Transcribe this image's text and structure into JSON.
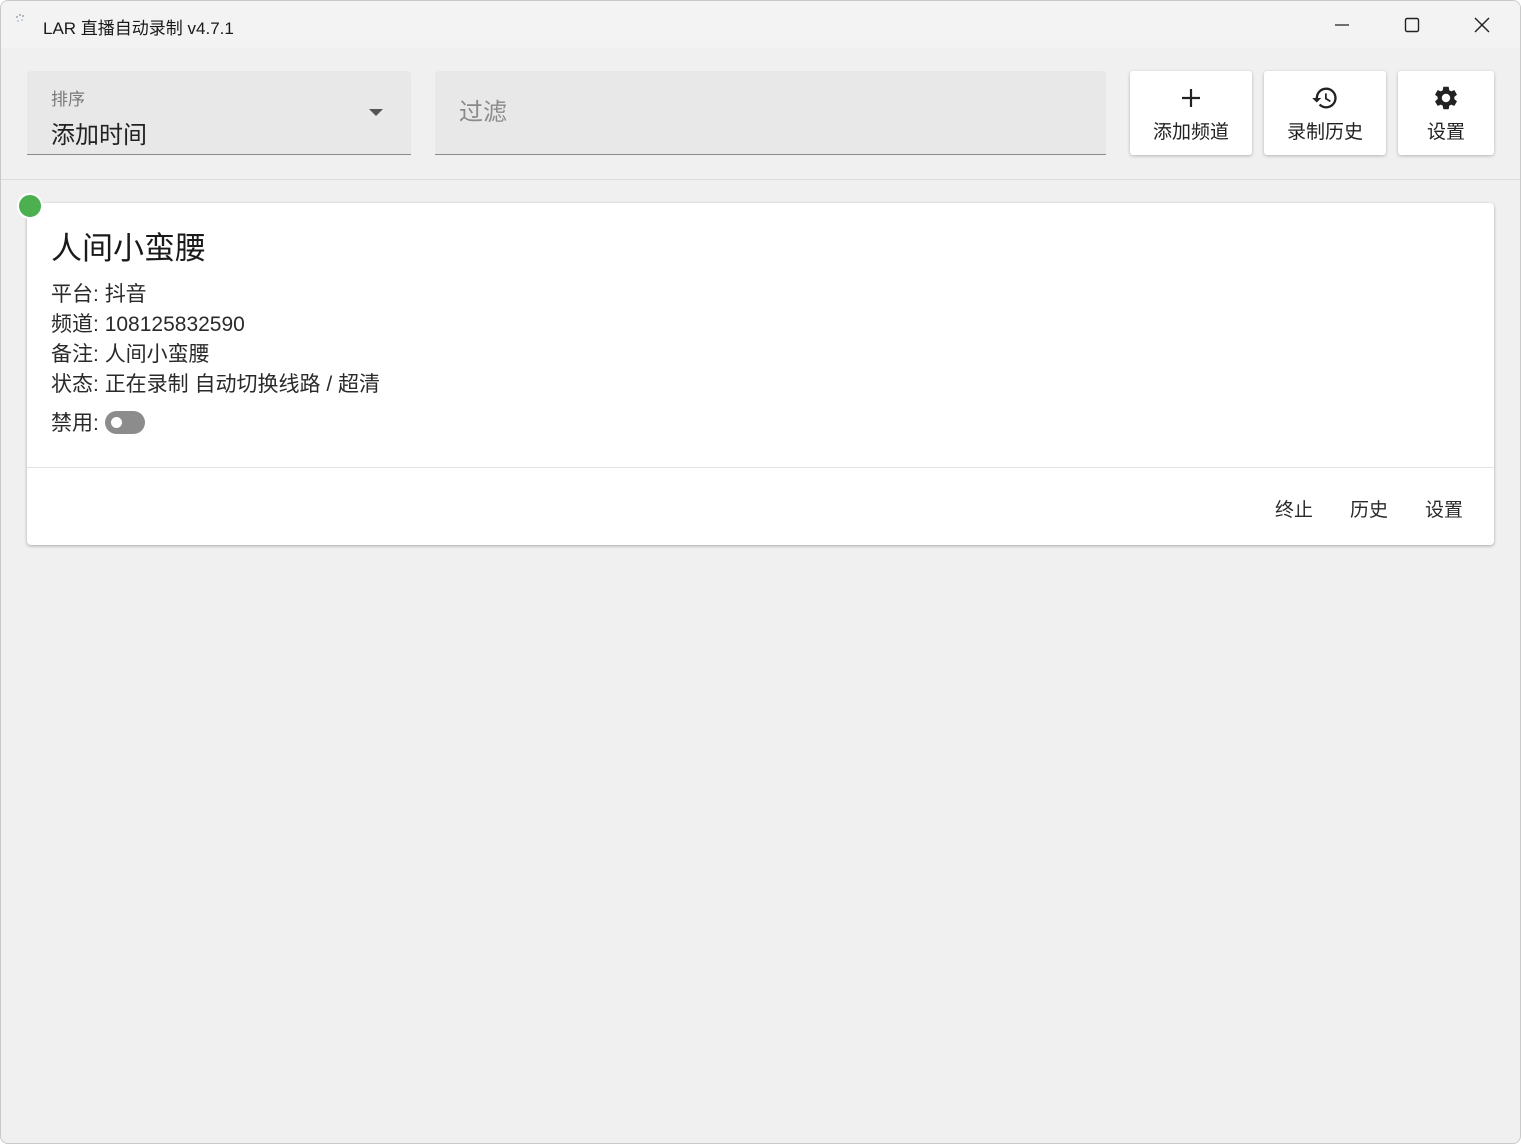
{
  "window": {
    "title": "LAR 直播自动录制 v4.7.1",
    "icons": {
      "app": "app-icon",
      "minimize": "minimize-icon",
      "maximize": "maximize-icon",
      "close": "close-icon"
    }
  },
  "toolbar": {
    "sort": {
      "label": "排序",
      "value": "添加时间"
    },
    "filter": {
      "placeholder": "过滤",
      "value": ""
    },
    "add_channel": {
      "label": "添加频道",
      "icon": "plus-icon"
    },
    "record_history": {
      "label": "录制历史",
      "icon": "history-icon"
    },
    "settings": {
      "label": "设置",
      "icon": "gear-icon"
    }
  },
  "channels": [
    {
      "name": "人间小蛮腰",
      "status_color": "#4caf50",
      "platform_label": "平台:",
      "platform": "抖音",
      "channel_label": "频道:",
      "channel": "108125832590",
      "remark_label": "备注:",
      "remark": "人间小蛮腰",
      "status_label": "状态:",
      "status": "正在录制 自动切换线路 / 超清",
      "disable_label": "禁用:",
      "disabled": false,
      "actions": {
        "stop": "终止",
        "history": "历史",
        "settings": "设置"
      }
    }
  ]
}
